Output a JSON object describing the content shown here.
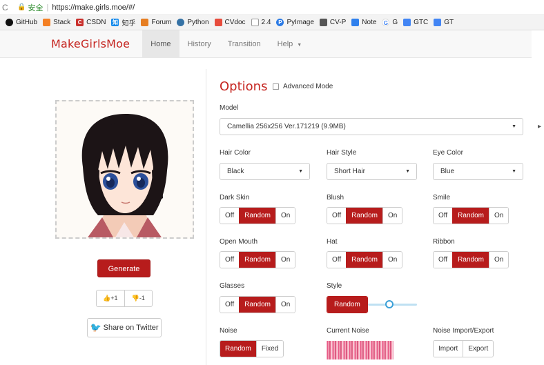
{
  "browser": {
    "secure_label": "安全",
    "url": "https://make.girls.moe/#/",
    "bookmarks": [
      {
        "label": "GitHub",
        "color": "#111111",
        "glyph": "●"
      },
      {
        "label": "Stack",
        "color": "#f48024",
        "glyph": "S"
      },
      {
        "label": "CSDN",
        "color": "#c9302c",
        "glyph": "C"
      },
      {
        "label": "知乎",
        "color": "#0f88eb",
        "glyph": "知"
      },
      {
        "label": "Forum",
        "color": "#e67e22",
        "glyph": "✦"
      },
      {
        "label": "Python",
        "color": "#3572a5",
        "glyph": "☯"
      },
      {
        "label": "CVdoc",
        "color": "#e74c3c",
        "glyph": "✦"
      },
      {
        "label": "2.4",
        "color": "#999999",
        "glyph": "▭"
      },
      {
        "label": "PyImage",
        "color": "#2c7be5",
        "glyph": "P"
      },
      {
        "label": "CV-P",
        "color": "#555555",
        "glyph": "▣"
      },
      {
        "label": "Note",
        "color": "#2f80ed",
        "glyph": "◆"
      },
      {
        "label": "G",
        "color": "#4285f4",
        "glyph": "G"
      },
      {
        "label": "GTC",
        "color": "#4285f4",
        "glyph": "▣"
      },
      {
        "label": "GT",
        "color": "#4285f4",
        "glyph": "▣"
      }
    ]
  },
  "navbar": {
    "brand": "MakeGirlsMoe",
    "items": [
      "Home",
      "History",
      "Transition",
      "Help"
    ]
  },
  "left": {
    "generate": "Generate",
    "vote_up": "+1",
    "vote_down": "-1",
    "twitter": "Share on Twitter"
  },
  "options": {
    "title": "Options",
    "advanced_mode": "Advanced Mode",
    "model_label": "Model",
    "model_value": "Camellia 256x256 Ver.171219 (9.9MB)",
    "hair_color_label": "Hair Color",
    "hair_color_value": "Black",
    "hair_style_label": "Hair Style",
    "hair_style_value": "Short Hair",
    "eye_color_label": "Eye Color",
    "eye_color_value": "Blue",
    "toggle_off": "Off",
    "toggle_random": "Random",
    "toggle_on": "On",
    "dark_skin": "Dark Skin",
    "blush": "Blush",
    "smile": "Smile",
    "open_mouth": "Open Mouth",
    "hat": "Hat",
    "ribbon": "Ribbon",
    "glasses": "Glasses",
    "style": "Style",
    "style_random": "Random",
    "noise": "Noise",
    "noise_random": "Random",
    "noise_fixed": "Fixed",
    "current_noise": "Current Noise",
    "noise_io": "Noise Import/Export",
    "import": "Import",
    "export": "Export"
  },
  "colors": {
    "accent": "#c5241f",
    "active_button": "#b71c1c"
  }
}
